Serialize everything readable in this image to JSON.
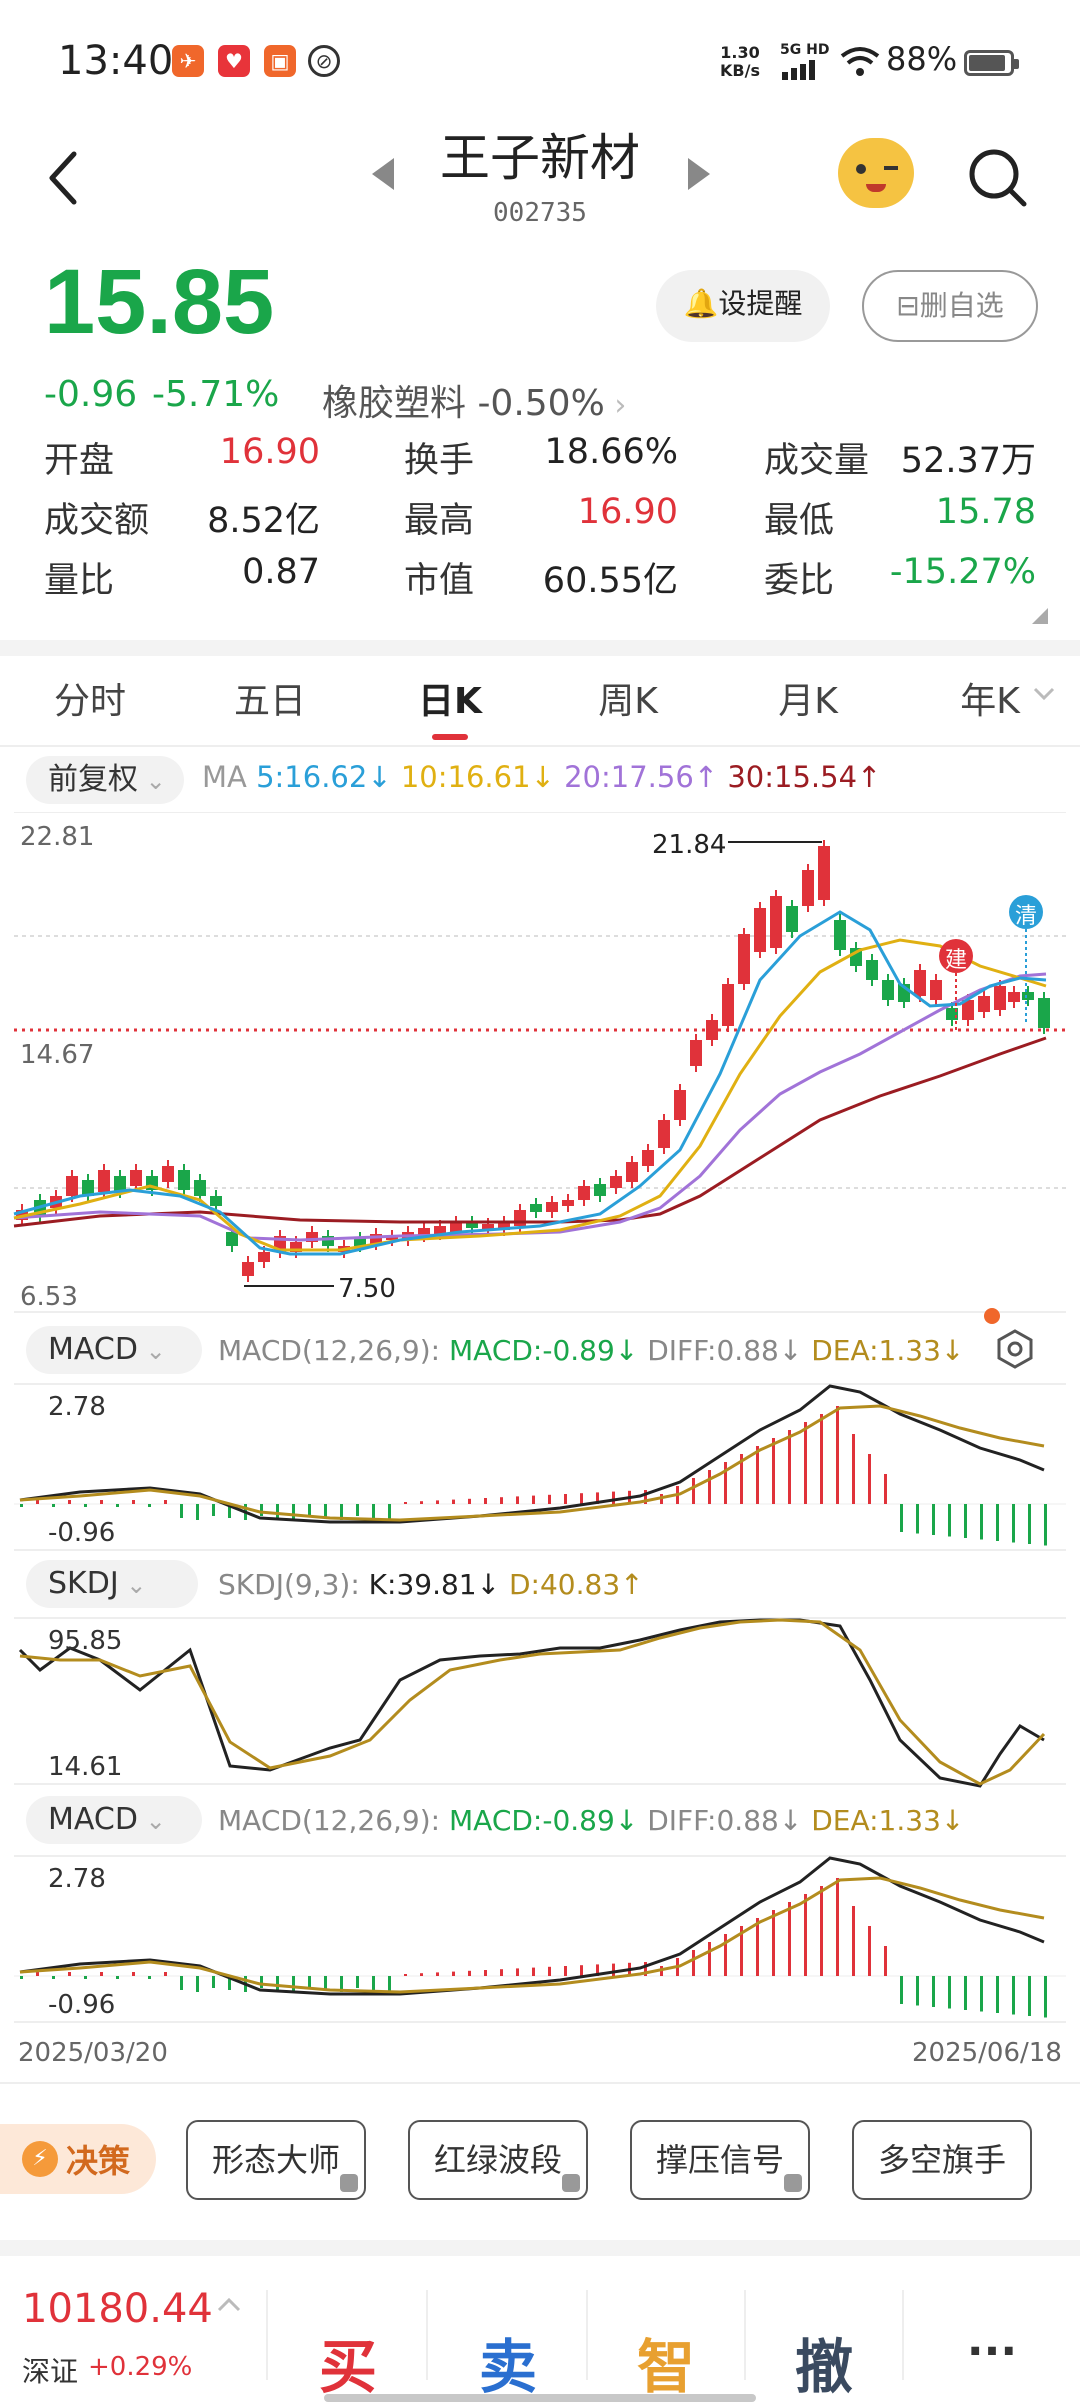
{
  "status_bar": {
    "time": "13:40",
    "net_speed_value": "1.30",
    "net_speed_unit": "KB/s",
    "signal_label": "5G HD",
    "battery": "88%"
  },
  "header": {
    "title": "王子新材",
    "code": "002735"
  },
  "quote": {
    "price": "15.85",
    "change": "-0.96",
    "change_pct": "-5.71%",
    "sector": "橡胶塑料 -0.50%",
    "alert_btn": "设提醒",
    "remove_btn": "删自选",
    "stats": [
      {
        "label": "开盘",
        "value": "16.90",
        "color": "red"
      },
      {
        "label": "换手",
        "value": "18.66%",
        "color": "black"
      },
      {
        "label": "成交量",
        "value": "52.37万",
        "color": "black"
      },
      {
        "label": "成交额",
        "value": "8.52亿",
        "color": "black"
      },
      {
        "label": "最高",
        "value": "16.90",
        "color": "red"
      },
      {
        "label": "最低",
        "value": "15.78",
        "color": "green"
      },
      {
        "label": "量比",
        "value": "0.87",
        "color": "black"
      },
      {
        "label": "市值",
        "value": "60.55亿",
        "color": "black"
      },
      {
        "label": "委比",
        "value": "-15.27%",
        "color": "green"
      }
    ]
  },
  "tabs": [
    "分时",
    "五日",
    "日K",
    "周K",
    "月K",
    "年K"
  ],
  "kline": {
    "adjust": "前复权",
    "ma_label": "MA",
    "ma5": "5:16.62",
    "ma10": "10:16.61",
    "ma20": "20:17.56",
    "ma30": "30:15.54",
    "y_top": "22.81",
    "y_mid": "14.67",
    "y_bottom": "6.53",
    "high_mark": "21.84",
    "low_mark": "7.50",
    "badge_build": "建",
    "badge_clear": "清",
    "colors": {
      "ma5": "#2a9fd8",
      "ma10": "#e0b012",
      "ma20": "#a173d8",
      "ma30": "#9b1c22"
    }
  },
  "macd1": {
    "name": "MACD",
    "params": "MACD(12,26,9):",
    "macd": "MACD:-0.89",
    "diff": "DIFF:0.88",
    "dea": "DEA:1.33",
    "y_top": "2.78",
    "y_bottom": "-0.96"
  },
  "skdj": {
    "name": "SKDJ",
    "params": "SKDJ(9,3):",
    "k": "K:39.81",
    "d": "D:40.83",
    "y_top": "95.85",
    "y_bottom": "14.61"
  },
  "macd2": {
    "name": "MACD",
    "params": "MACD(12,26,9):",
    "macd": "MACD:-0.89",
    "diff": "DIFF:0.88",
    "dea": "DEA:1.33",
    "y_top": "2.78",
    "y_bottom": "-0.96"
  },
  "date_start": "2025/03/20",
  "date_end": "2025/06/18",
  "tools": {
    "decide": "决策",
    "buttons": [
      "形态大师",
      "红绿波段",
      "撑压信号",
      "多空旗手"
    ]
  },
  "bottom": {
    "index_value": "10180.44",
    "index_name": "深证",
    "index_change": "+0.29%",
    "buy": "买",
    "sell": "卖",
    "smart": "智",
    "cancel": "撤",
    "more": "···"
  }
}
